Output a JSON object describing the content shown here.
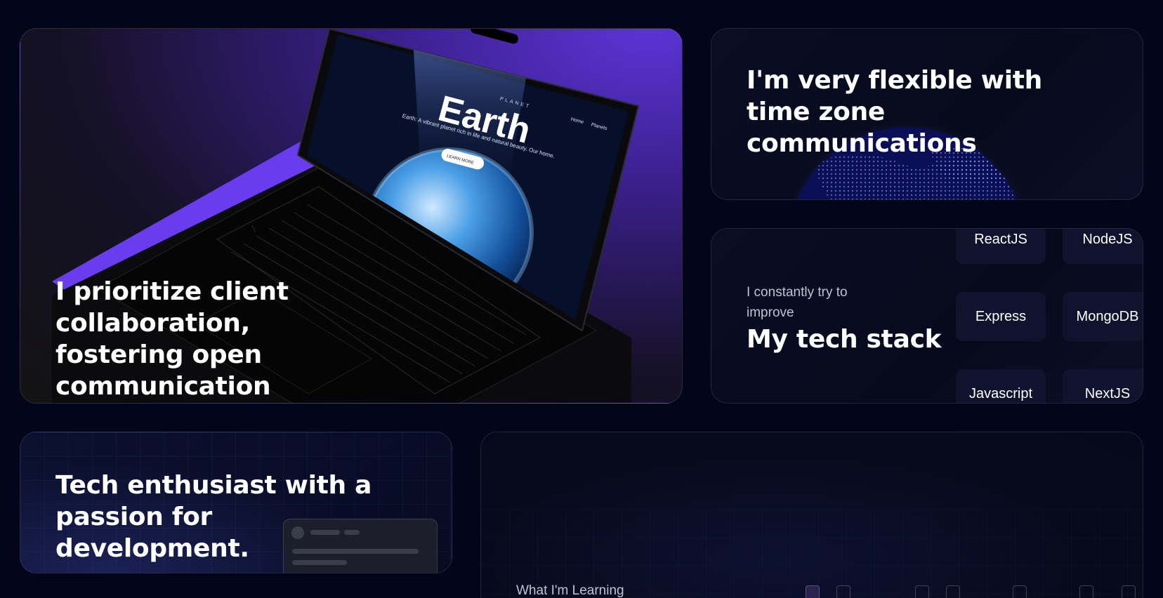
{
  "cards": {
    "collaboration": {
      "title": "I prioritize client collaboration, fostering open communication",
      "screen": {
        "brand_small": "PLANET",
        "brand_big": "Earth",
        "tagline": "Earth: A vibrant planet rich in life and natural beauty. Our home.",
        "nav": [
          "Home",
          "Planets"
        ],
        "cta": "LEARN MORE"
      }
    },
    "timezone": {
      "title": "I'm very flexible with time zone communications"
    },
    "tech_stack": {
      "subtitle": "I constantly try to improve",
      "title": "My tech stack",
      "items": [
        "ReactJS",
        "NodeJS",
        "Express",
        "MongoDB",
        "Javascript",
        "NextJS"
      ]
    },
    "enthusiast": {
      "title": "Tech enthusiast with a passion for development."
    },
    "learning": {
      "label": "What I'm Learning"
    }
  },
  "colors": {
    "page_bg": "#03061a",
    "accent_purple": "#5b34d6",
    "pill_bg": "#10132e"
  }
}
